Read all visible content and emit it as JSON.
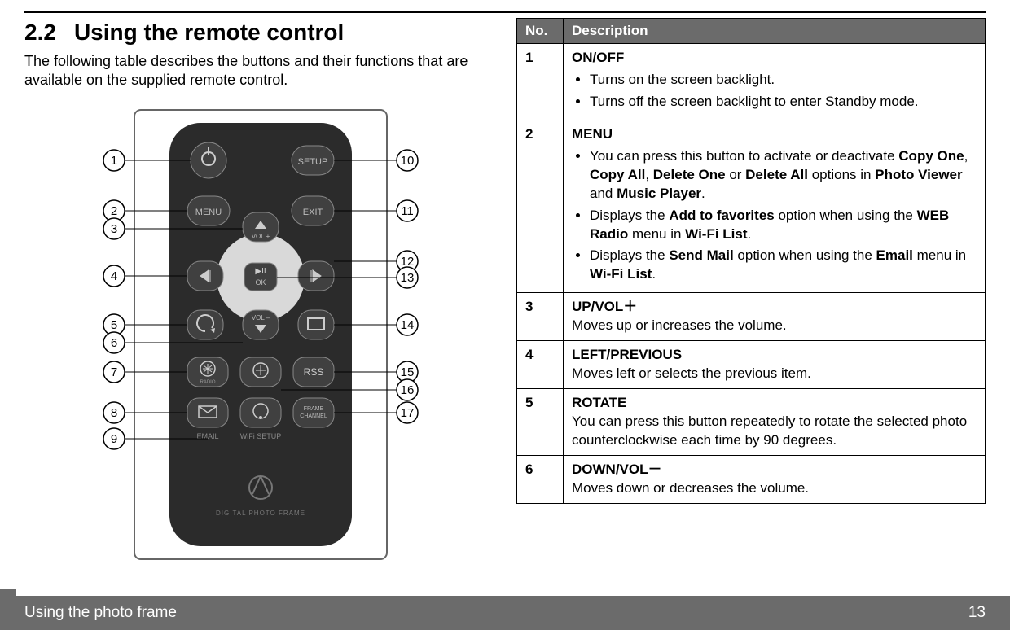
{
  "section": {
    "number": "2.2",
    "title": "Using the remote control"
  },
  "intro": "The following table describes the buttons and their functions that are available on the supplied remote control.",
  "table": {
    "head": {
      "no": "No.",
      "desc": "Description"
    },
    "rows": [
      {
        "no": "1",
        "name": "ON/OFF",
        "bullets": [
          "Turns on the screen backlight.",
          "Turns off the screen backlight to enter Standby mode."
        ]
      },
      {
        "no": "2",
        "name": "MENU",
        "bullets_html": [
          "You can press this button to activate or deactivate <span class='b'>Copy One</span>, <span class='b'>Copy All</span>, <span class='b'>Delete One</span> or <span class='b'>Delete All</span> options in <span class='b'>Photo Viewer</span> and <span class='b'>Music Player</span>.",
          "Displays the <span class='b'>Add to favorites</span> option when using the <span class='b'>WEB Radio</span> menu in <span class='b'>Wi-Fi List</span>.",
          "Displays the <span class='b'>Send Mail</span> option when using the <span class='b'>Email</span> menu in <span class='b'>Wi-Fi List</span>."
        ]
      },
      {
        "no": "3",
        "name": "UP/VOL＋",
        "text": "Moves up or increases the volume."
      },
      {
        "no": "4",
        "name": "LEFT/PREVIOUS",
        "text": "Moves left or selects the previous item."
      },
      {
        "no": "5",
        "name": "ROTATE",
        "text": "You can press this button repeatedly to rotate the selected photo counterclockwise each time by 90 degrees."
      },
      {
        "no": "6",
        "name": "DOWN/VOL－",
        "text": "Moves down or decreases the volume."
      }
    ]
  },
  "footer": {
    "left": "Using the photo frame",
    "right": "13"
  },
  "callouts_left": [
    "1",
    "2",
    "3",
    "4",
    "5",
    "6",
    "7",
    "8",
    "9"
  ],
  "callouts_right": [
    "10",
    "11",
    "12",
    "13",
    "14",
    "15",
    "16",
    "17"
  ],
  "remote_labels": {
    "setup": "SETUP",
    "menu": "MENU",
    "exit": "EXIT",
    "volp": "VOL +",
    "volm": "VOL –",
    "ok": "OK",
    "rss": "RSS",
    "radio": "RADIO",
    "frame": "FRAME\nCHANNEL",
    "email": "EMAIL",
    "wifi": "WiFi SETUP",
    "brand": "DIGITAL PHOTO FRAME"
  }
}
